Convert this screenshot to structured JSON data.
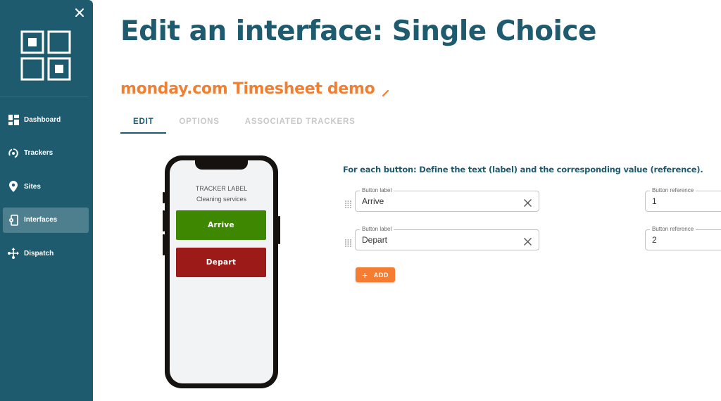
{
  "sidebar": {
    "close_icon": "close-icon",
    "logo_icon": "grid-logo-icon",
    "items": [
      {
        "label": "Dashboard",
        "icon": "dashboard-icon",
        "active": false
      },
      {
        "label": "Trackers",
        "icon": "trackers-icon",
        "active": false
      },
      {
        "label": "Sites",
        "icon": "location-pin-icon",
        "active": false
      },
      {
        "label": "Interfaces",
        "icon": "interfaces-icon",
        "active": true
      },
      {
        "label": "Dispatch",
        "icon": "dispatch-icon",
        "active": false
      }
    ]
  },
  "header": {
    "title": "Edit an interface: Single Choice",
    "subtitle": "monday.com Timesheet demo",
    "edit_icon": "pencil-icon"
  },
  "tabs": [
    {
      "label": "EDIT",
      "active": true
    },
    {
      "label": "OPTIONS",
      "active": false
    },
    {
      "label": "ASSOCIATED TRACKERS",
      "active": false
    }
  ],
  "preview": {
    "tracker_label": "TRACKER LABEL",
    "tracker_subtitle": "Cleaning services",
    "buttons": [
      {
        "label": "Arrive",
        "color": "#3e8700"
      },
      {
        "label": "Depart",
        "color": "#9c1a17"
      }
    ]
  },
  "editor": {
    "instructions": "For each button: Define the text (label) and the corresponding value (reference).",
    "rows": [
      {
        "label_field": {
          "label": "Button label",
          "value": "Arrive"
        },
        "reference_field": {
          "label": "Button reference",
          "value": "1"
        }
      },
      {
        "label_field": {
          "label": "Button label",
          "value": "Depart"
        },
        "reference_field": {
          "label": "Button reference",
          "value": "2"
        }
      }
    ],
    "add_label": "ADD"
  },
  "colors": {
    "primary": "#1e5b6f",
    "accent": "#f07f32",
    "add_button": "#f47d31"
  }
}
